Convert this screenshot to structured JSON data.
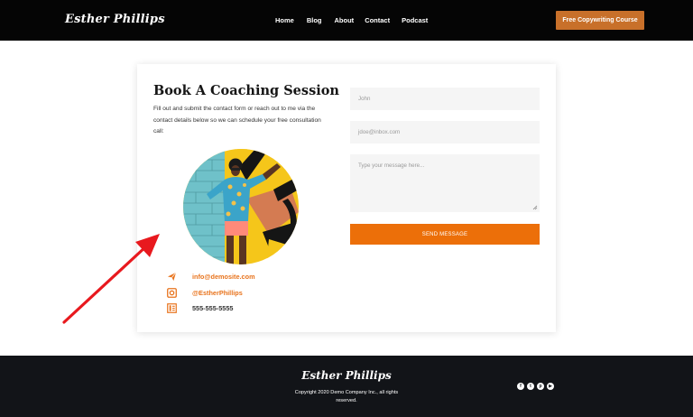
{
  "header": {
    "logo": "Esther Phillips",
    "nav": [
      "Home",
      "Blog",
      "About",
      "Contact",
      "Podcast"
    ],
    "cta": "Free Copywriting Course"
  },
  "main": {
    "title": "Book A Coaching Session",
    "description": "Fill out and submit the contact form or reach out to me via the contact details below so we can schedule your free consultation call:",
    "contacts": [
      {
        "icon": "send-icon",
        "text": "info@demosite.com"
      },
      {
        "icon": "instagram-icon",
        "text": "@EstherPhillips"
      },
      {
        "icon": "phone-icon",
        "text": "555-555-5555"
      }
    ]
  },
  "form": {
    "name_placeholder": "John",
    "email_placeholder": "jdoe@inbox.com",
    "message_placeholder": "Type your message here...",
    "submit": "SEND MESSAGE"
  },
  "footer": {
    "logo": "Esther Phillips",
    "copyright": "Copyright 2020 Demo Company Inc., all rights reserved.",
    "social": [
      "facebook-icon",
      "twitter-icon",
      "pinterest-icon",
      "youtube-icon"
    ],
    "social_glyphs": [
      "f",
      "t",
      "p",
      "▶"
    ]
  },
  "colors": {
    "accent": "#ec6f09",
    "cta": "#c8702a",
    "header_bg": "#050505",
    "footer_bg": "#121418",
    "annotation_arrow": "#e8191e"
  }
}
